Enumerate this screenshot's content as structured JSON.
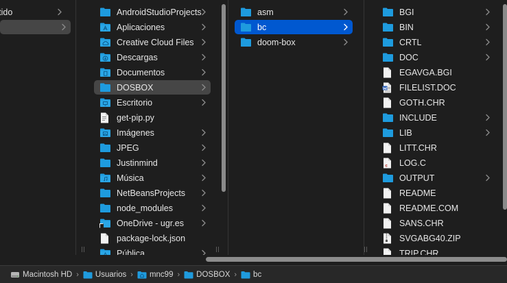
{
  "columns": [
    {
      "items": [
        {
          "label": "rtido",
          "icon": "none",
          "chevron": true,
          "selected": false
        },
        {
          "label": "",
          "icon": "none",
          "chevron": true,
          "selected": "grey"
        }
      ]
    },
    {
      "items": [
        {
          "label": "AndroidStudioProjects",
          "icon": "folder-icon",
          "chevron": true,
          "selected": false
        },
        {
          "label": "Aplicaciones",
          "icon": "apps-folder-icon",
          "chevron": true,
          "selected": false
        },
        {
          "label": "Creative Cloud Files",
          "icon": "creative-cloud-folder-icon",
          "chevron": true,
          "selected": false
        },
        {
          "label": "Descargas",
          "icon": "downloads-folder-icon",
          "chevron": true,
          "selected": false
        },
        {
          "label": "Documentos",
          "icon": "documents-folder-icon",
          "chevron": true,
          "selected": false
        },
        {
          "label": "DOSBOX",
          "icon": "folder-icon",
          "chevron": true,
          "selected": "grey"
        },
        {
          "label": "Escritorio",
          "icon": "desktop-folder-icon",
          "chevron": true,
          "selected": false
        },
        {
          "label": "get-pip.py",
          "icon": "python-file-icon",
          "chevron": false,
          "selected": false
        },
        {
          "label": "Imágenes",
          "icon": "pictures-folder-icon",
          "chevron": true,
          "selected": false
        },
        {
          "label": "JPEG",
          "icon": "folder-icon",
          "chevron": true,
          "selected": false
        },
        {
          "label": "Justinmind",
          "icon": "folder-icon",
          "chevron": true,
          "selected": false
        },
        {
          "label": "Música",
          "icon": "music-folder-icon",
          "chevron": true,
          "selected": false
        },
        {
          "label": "NetBeansProjects",
          "icon": "folder-icon",
          "chevron": true,
          "selected": false
        },
        {
          "label": "node_modules",
          "icon": "folder-icon",
          "chevron": true,
          "selected": false
        },
        {
          "label": "OneDrive - ugr.es",
          "icon": "onedrive-folder-icon",
          "chevron": true,
          "selected": false
        },
        {
          "label": "package-lock.json",
          "icon": "json-file-icon",
          "chevron": false,
          "selected": false
        },
        {
          "label": "Pública",
          "icon": "public-folder-icon",
          "chevron": true,
          "selected": false
        }
      ]
    },
    {
      "items": [
        {
          "label": "asm",
          "icon": "folder-icon",
          "chevron": true,
          "selected": false
        },
        {
          "label": "bc",
          "icon": "folder-icon",
          "chevron": true,
          "selected": "blue"
        },
        {
          "label": "doom-box",
          "icon": "folder-icon",
          "chevron": true,
          "selected": false
        }
      ]
    },
    {
      "items": [
        {
          "label": "BGI",
          "icon": "folder-icon",
          "chevron": true,
          "selected": false
        },
        {
          "label": "BIN",
          "icon": "folder-icon",
          "chevron": true,
          "selected": false
        },
        {
          "label": "CRTL",
          "icon": "folder-icon",
          "chevron": true,
          "selected": false
        },
        {
          "label": "DOC",
          "icon": "folder-icon",
          "chevron": true,
          "selected": false
        },
        {
          "label": "EGAVGA.BGI",
          "icon": "document-file-icon",
          "chevron": false,
          "selected": false
        },
        {
          "label": "FILELIST.DOC",
          "icon": "word-file-icon",
          "chevron": false,
          "selected": false
        },
        {
          "label": "GOTH.CHR",
          "icon": "document-file-icon",
          "chevron": false,
          "selected": false
        },
        {
          "label": "INCLUDE",
          "icon": "folder-icon",
          "chevron": true,
          "selected": false
        },
        {
          "label": "LIB",
          "icon": "folder-icon",
          "chevron": true,
          "selected": false
        },
        {
          "label": "LITT.CHR",
          "icon": "document-file-icon",
          "chevron": false,
          "selected": false
        },
        {
          "label": "LOG.C",
          "icon": "c-source-file-icon",
          "chevron": false,
          "selected": false
        },
        {
          "label": "OUTPUT",
          "icon": "folder-icon",
          "chevron": true,
          "selected": false
        },
        {
          "label": "README",
          "icon": "document-file-icon",
          "chevron": false,
          "selected": false
        },
        {
          "label": "README.COM",
          "icon": "document-file-icon",
          "chevron": false,
          "selected": false
        },
        {
          "label": "SANS.CHR",
          "icon": "document-file-icon",
          "chevron": false,
          "selected": false
        },
        {
          "label": "SVGABG40.ZIP",
          "icon": "zip-file-icon",
          "chevron": false,
          "selected": false
        },
        {
          "label": "TRIP.CHR",
          "icon": "document-file-icon",
          "chevron": false,
          "selected": false
        }
      ]
    }
  ],
  "path_bar": [
    {
      "label": "Macintosh HD",
      "icon": "hard-drive-icon"
    },
    {
      "label": "Usuarios",
      "icon": "folder-icon"
    },
    {
      "label": "mnc99",
      "icon": "home-folder-icon"
    },
    {
      "label": "DOSBOX",
      "icon": "folder-icon"
    },
    {
      "label": "bc",
      "icon": "folder-icon"
    }
  ],
  "path_separator": "›",
  "colors": {
    "folder": "#1f9bde",
    "selection_blue": "#0058d0",
    "selection_grey": "#464646",
    "background": "#1e1e1e"
  }
}
